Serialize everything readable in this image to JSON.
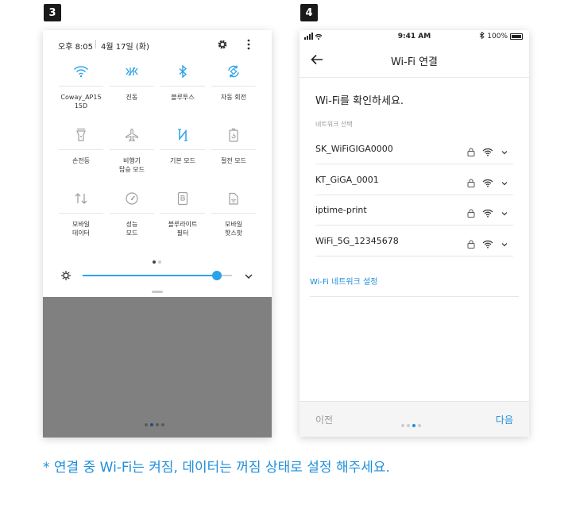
{
  "steps": {
    "left": "3",
    "right": "4"
  },
  "quick_panel": {
    "time": "오후 8:05",
    "date": "4월 17일 (화)",
    "tiles": [
      {
        "label": "Coway_AP15\n15D",
        "icon": "wifi-icon",
        "active": true
      },
      {
        "label": "진동",
        "icon": "vibrate-icon",
        "active": true
      },
      {
        "label": "블루투스",
        "icon": "bluetooth-icon",
        "active": true
      },
      {
        "label": "자동 회전",
        "icon": "auto-rotate-icon",
        "active": true
      },
      {
        "label": "손전등",
        "icon": "flashlight-icon",
        "active": false
      },
      {
        "label": "비행기\n탑승 모드",
        "icon": "airplane-icon",
        "active": false
      },
      {
        "label": "기본 모드",
        "icon": "nfc-icon",
        "active": true
      },
      {
        "label": "절전 모드",
        "icon": "battery-saver-icon",
        "active": false
      },
      {
        "label": "모바일\n데이터",
        "icon": "mobile-data-icon",
        "active": false
      },
      {
        "label": "성능\n모드",
        "icon": "performance-icon",
        "active": false
      },
      {
        "label": "블루라이트\n필터",
        "icon": "blue-light-icon",
        "active": false
      },
      {
        "label": "모바일\n핫스팟",
        "icon": "hotspot-icon",
        "active": false
      }
    ],
    "brightness": 0.9,
    "page_index": 0,
    "page_count": 2,
    "home_page_index": 1,
    "home_page_count": 4
  },
  "wifi_screen": {
    "status_time": "9:41 AM",
    "battery": "100%",
    "title": "Wi-Fi 연결",
    "heading": "Wi-Fi를 확인하세요.",
    "section_label": "네트워크 선택",
    "networks": [
      {
        "name": "SK_WiFiGIGA0000"
      },
      {
        "name": "KT_GiGA_0001"
      },
      {
        "name": "iptime-print"
      },
      {
        "name": "WiFi_5G_12345678"
      }
    ],
    "settings_link": "Wi-Fi 네트워크 설정",
    "prev_label": "이전",
    "next_label": "다음",
    "step_index": 2,
    "step_count": 4
  },
  "footnote": "* 연결 중 Wi-Fi는 켜짐, 데이터는 꺼짐 상태로 설정 해주세요.",
  "colors": {
    "accent": "#1f8fdb",
    "active_icon": "#2aa3e8",
    "inactive_icon": "#a0a0a0"
  }
}
